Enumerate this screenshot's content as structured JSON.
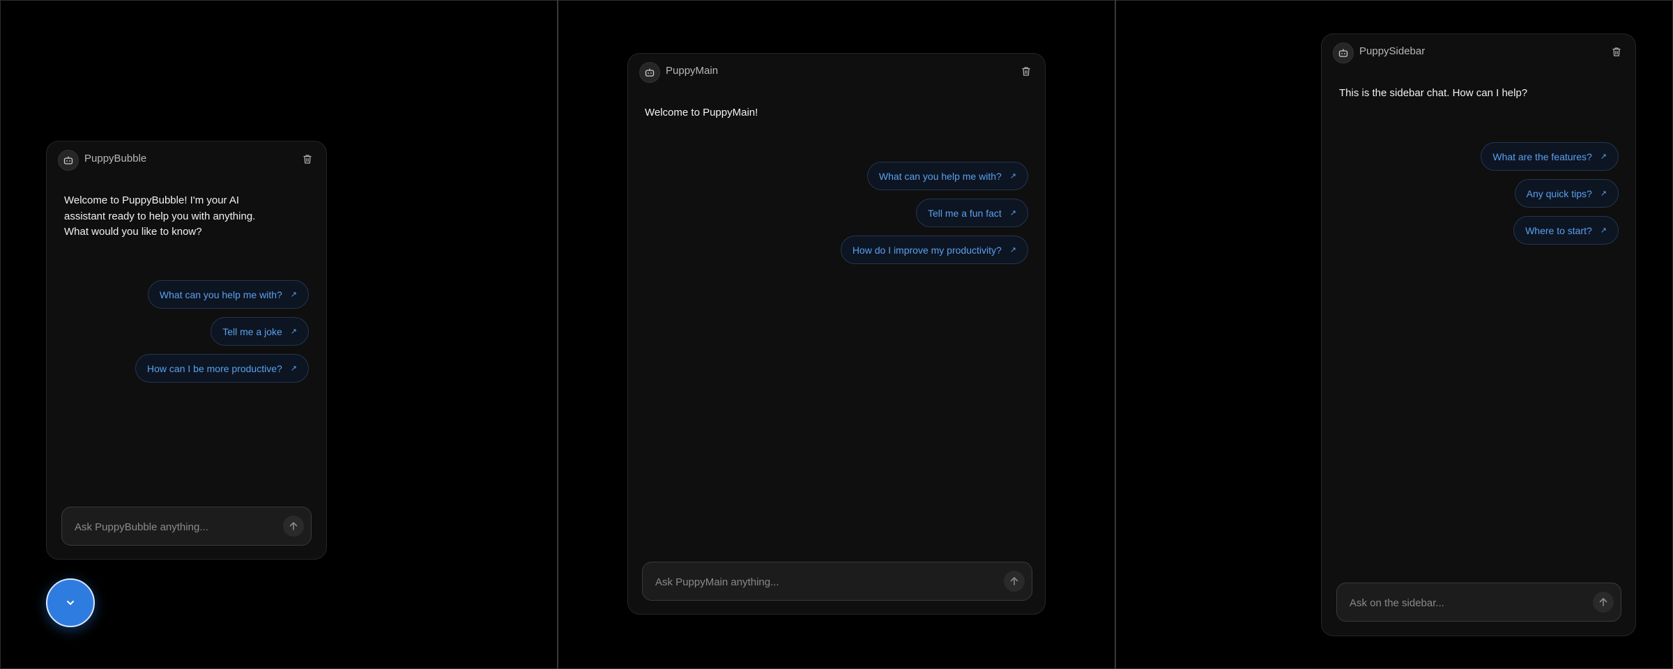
{
  "bubble": {
    "title": "PuppyBubble",
    "welcome_line1": "Welcome to PuppyBubble! I'm your AI",
    "welcome_line2": "assistant ready to help you with anything.",
    "welcome_line3": "What would you like to know?",
    "suggestions": [
      "What can you help me with?",
      "Tell me a joke",
      "How can I be more productive?"
    ],
    "placeholder": "Ask PuppyBubble anything..."
  },
  "main": {
    "title": "PuppyMain",
    "welcome": "Welcome to PuppyMain!",
    "suggestions": [
      "What can you help me with?",
      "Tell me a fun fact",
      "How do I improve my productivity?"
    ],
    "placeholder": "Ask PuppyMain anything..."
  },
  "sidebar": {
    "title": "PuppySidebar",
    "welcome": "This is the sidebar chat. How can I help?",
    "suggestions": [
      "What are the features?",
      "Any quick tips?",
      "Where to start?"
    ],
    "placeholder": "Ask on the sidebar..."
  },
  "icons": {
    "avatar": "robot-icon",
    "delete": "trash-icon",
    "suggestion": "arrow-up-right-icon",
    "send": "arrow-up-icon",
    "fab": "chevron-down-icon"
  },
  "colors": {
    "background": "#000000",
    "panel": "#0f0f0f",
    "accent": "#5aa0ee",
    "fab": "#2f7ce0"
  }
}
